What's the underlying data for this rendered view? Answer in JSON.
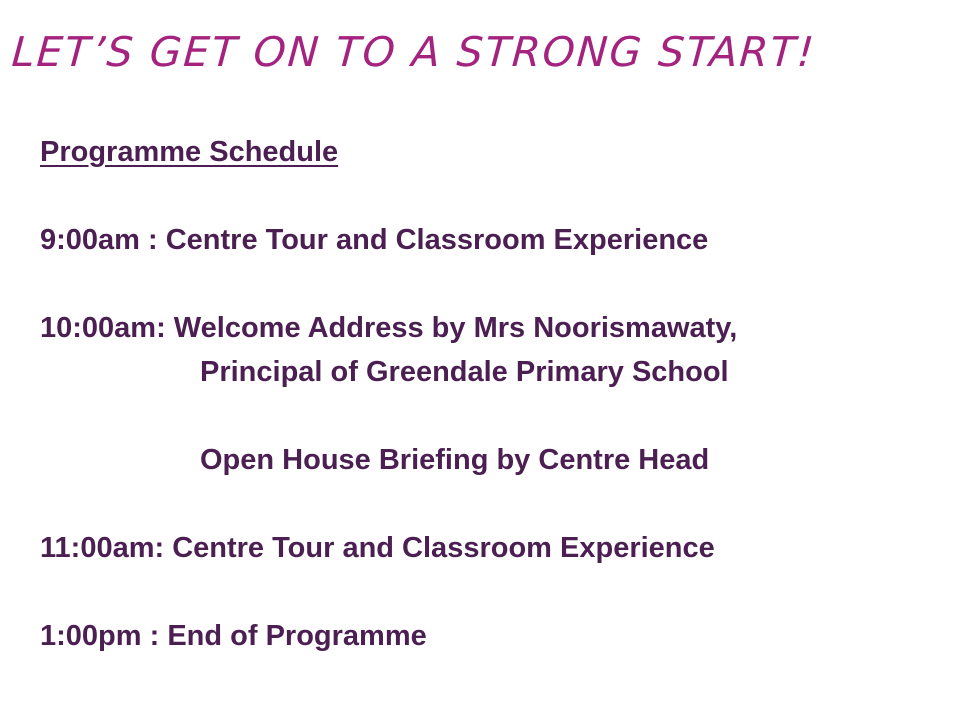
{
  "title": "LET’S GET ON TO A STRONG START!",
  "schedule": {
    "heading": "Programme Schedule",
    "items": [
      "9:00am : Centre Tour and Classroom Experience",
      "10:00am: Welcome Address by Mrs Noorismawaty,",
      "Principal of Greendale Primary School",
      "Open House Briefing by Centre Head",
      "11:00am: Centre Tour and Classroom Experience",
      "1:00pm : End of Programme"
    ]
  },
  "colors": {
    "title": "#a3237f",
    "body_text": "#4b1f52",
    "background": "#ffffff"
  }
}
